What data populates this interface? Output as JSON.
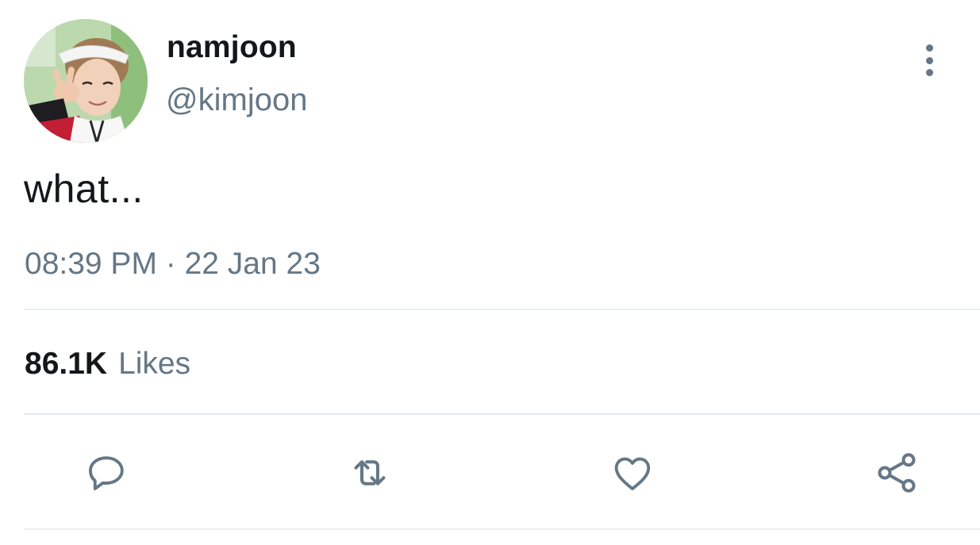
{
  "user": {
    "display_name": "namjoon",
    "handle": "@kimjoon"
  },
  "tweet": {
    "text": "what...",
    "timestamp": "08:39 PM · 22 Jan 23"
  },
  "stats": {
    "likes_count": "86.1K",
    "likes_label": "Likes"
  },
  "actions": {
    "reply_icon": "reply-icon",
    "retweet_icon": "retweet-icon",
    "like_icon": "heart-icon",
    "share_icon": "share-icon"
  },
  "colors": {
    "primary_text": "#14171a",
    "secondary_text": "#657786",
    "divider": "#e6ecf0"
  }
}
